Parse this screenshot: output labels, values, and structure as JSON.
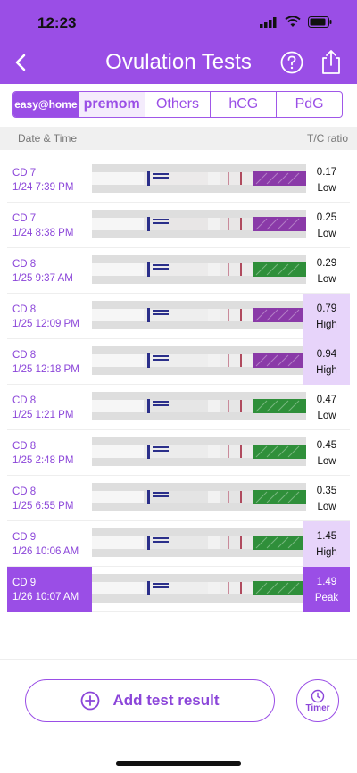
{
  "status": {
    "time": "12:23"
  },
  "header": {
    "title": "Ovulation Tests"
  },
  "tabs": [
    {
      "label": "easy@home",
      "active": true
    },
    {
      "label": "premom"
    },
    {
      "label": "Others"
    },
    {
      "label": "hCG"
    },
    {
      "label": "PdG"
    }
  ],
  "columns": {
    "date": "Date & Time",
    "ratio": "T/C ratio"
  },
  "rows": [
    {
      "cd": "CD 7",
      "dt": "1/24 7:39 PM",
      "val": "0.17",
      "level": "Low",
      "handle": "purple",
      "shade": "#eceaea"
    },
    {
      "cd": "CD 7",
      "dt": "1/24 8:38 PM",
      "val": "0.25",
      "level": "Low",
      "handle": "purple",
      "shade": "#e8e6e6"
    },
    {
      "cd": "CD 8",
      "dt": "1/25 9:37 AM",
      "val": "0.29",
      "level": "Low",
      "handle": "green",
      "shade": "#ecebeb"
    },
    {
      "cd": "CD 8",
      "dt": "1/25 12:09 PM",
      "val": "0.79",
      "level": "High",
      "handle": "purple",
      "shade": "#eeeeee"
    },
    {
      "cd": "CD 8",
      "dt": "1/25 12:18 PM",
      "val": "0.94",
      "level": "High",
      "handle": "purple",
      "shade": "#eeeeee"
    },
    {
      "cd": "CD 8",
      "dt": "1/25 1:21 PM",
      "val": "0.47",
      "level": "Low",
      "handle": "green",
      "shade": "#e6e6e6"
    },
    {
      "cd": "CD 8",
      "dt": "1/25 2:48 PM",
      "val": "0.45",
      "level": "Low",
      "handle": "green",
      "shade": "#ececec"
    },
    {
      "cd": "CD 8",
      "dt": "1/25 6:55 PM",
      "val": "0.35",
      "level": "Low",
      "handle": "green",
      "shade": "#e4e4e4"
    },
    {
      "cd": "CD 9",
      "dt": "1/26 10:06 AM",
      "val": "1.45",
      "level": "High",
      "handle": "green",
      "shade": "#e8e8e8"
    },
    {
      "cd": "CD 9",
      "dt": "1/26 10:07 AM",
      "val": "1.49",
      "level": "Peak",
      "handle": "green",
      "shade": "#eeeeee",
      "selected": true
    }
  ],
  "actions": {
    "add": "Add test result",
    "timer": "Timer"
  },
  "colors": {
    "accent": "#9a4ee6",
    "high": "#e7d4fa"
  }
}
